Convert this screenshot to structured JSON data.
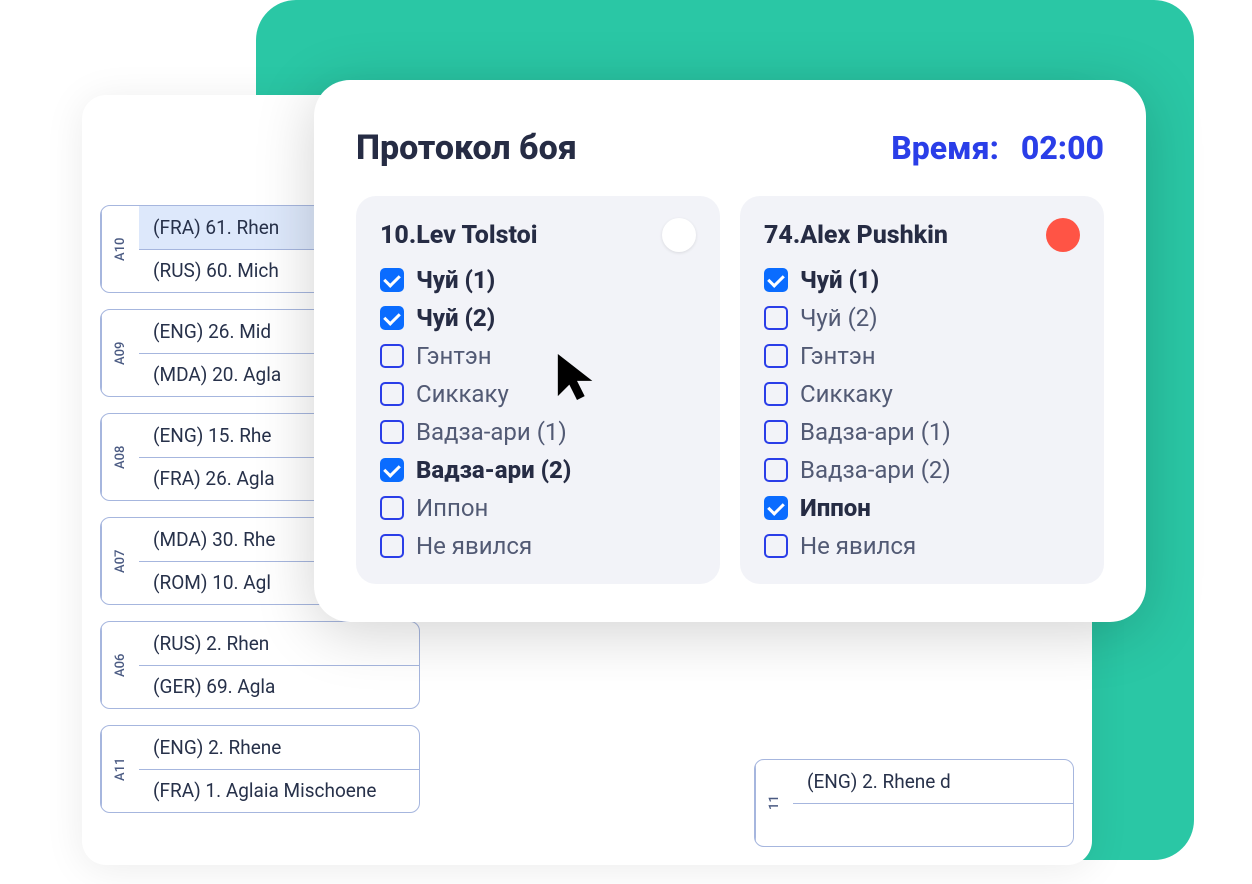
{
  "modal": {
    "title": "Протокол боя",
    "time_label": "Время:",
    "time_value": "02:00"
  },
  "fighters": [
    {
      "name": "10.Lev Tolstoi",
      "color": "white",
      "checks": [
        {
          "label": "Чуй (1)",
          "checked": true
        },
        {
          "label": "Чуй (2)",
          "checked": true
        },
        {
          "label": "Гэнтэн",
          "checked": false
        },
        {
          "label": "Сиккаку",
          "checked": false
        },
        {
          "label": "Вадза-ари (1)",
          "checked": false
        },
        {
          "label": "Вадза-ари (2)",
          "checked": true
        },
        {
          "label": "Иппон",
          "checked": false
        },
        {
          "label": "Не явился",
          "checked": false
        }
      ]
    },
    {
      "name": "74.Alex Pushkin",
      "color": "red",
      "checks": [
        {
          "label": "Чуй (1)",
          "checked": true
        },
        {
          "label": "Чуй (2)",
          "checked": false
        },
        {
          "label": "Гэнтэн",
          "checked": false
        },
        {
          "label": "Сиккаку",
          "checked": false
        },
        {
          "label": "Вадза-ари (1)",
          "checked": false
        },
        {
          "label": "Вадза-ари (2)",
          "checked": false
        },
        {
          "label": "Иппон",
          "checked": true
        },
        {
          "label": "Не явился",
          "checked": false
        }
      ]
    }
  ],
  "brackets_left": [
    {
      "tag": "A10",
      "rows": [
        "(FRA) 61. Rhen",
        "(RUS) 60. Mich"
      ],
      "hl": 0
    },
    {
      "tag": "A09",
      "rows": [
        "(ENG) 26. Mid",
        "(MDA) 20. Agla"
      ],
      "hl": -1
    },
    {
      "tag": "A08",
      "rows": [
        "(ENG) 15. Rhe",
        "(FRA) 26. Agla"
      ],
      "hl": -1
    },
    {
      "tag": "A07",
      "rows": [
        "(MDA) 30. Rhe",
        "(ROM) 10. Agl"
      ],
      "hl": -1
    },
    {
      "tag": "A06",
      "rows": [
        "(RUS) 2. Rhen",
        "(GER) 69. Agla"
      ],
      "hl": -1
    },
    {
      "tag": "A11",
      "rows": [
        "(ENG) 2. Rhene",
        "(FRA) 1. Aglaia Mischoene"
      ],
      "hl": -1
    }
  ],
  "brackets_right": [
    {
      "tag": "11",
      "rows": [
        "(ENG) 2. Rhene d",
        ""
      ],
      "hl": -1
    }
  ]
}
